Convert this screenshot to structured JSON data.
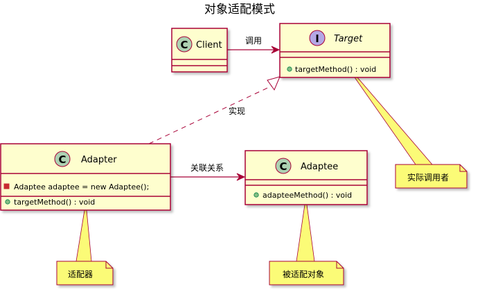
{
  "title": "对象适配模式",
  "classes": {
    "client": {
      "stereotype": "C",
      "name": "Client"
    },
    "target": {
      "stereotype": "I",
      "name": "Target",
      "methods": [
        "targetMethod() : void"
      ]
    },
    "adapter": {
      "stereotype": "C",
      "name": "Adapter",
      "fields": [
        "Adaptee adaptee = new Adaptee();"
      ],
      "methods": [
        "targetMethod() : void"
      ]
    },
    "adaptee": {
      "stereotype": "C",
      "name": "Adaptee",
      "methods": [
        "adapteeMethod() : void"
      ]
    }
  },
  "relations": {
    "call": "调用",
    "realize": "实现",
    "associate": "关联关系"
  },
  "notes": {
    "target_note": "实际调用者",
    "adapter_note": "适配器",
    "adaptee_note": "被适配对象"
  },
  "colors": {
    "class_fill": "#FEFECE",
    "class_border": "#A80036",
    "class_circle": "#ADD1B2",
    "interface_circle": "#B4A7E5",
    "note_fill": "#FBFB77",
    "arrow": "#A80036",
    "method_public": "#84BE84",
    "field_private": "#C82930"
  }
}
